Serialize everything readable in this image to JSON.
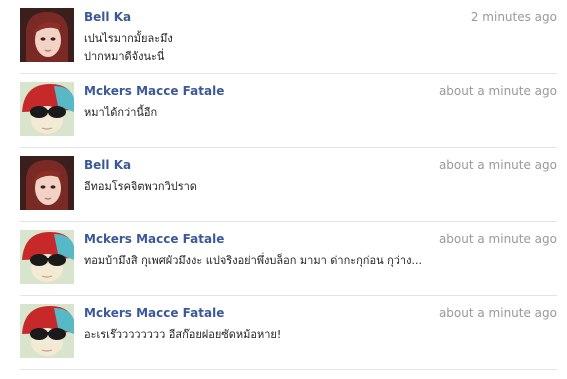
{
  "messages": [
    {
      "author": "Bell Ka",
      "time": "2 minutes ago",
      "avatar_icon": "girl-portrait-avatar",
      "lines": [
        "เปนไรมากมั้ยละมึง",
        "ปากหมาดีจังนะนี่"
      ]
    },
    {
      "author": "Mckers Macce Fatale",
      "time": "about a minute ago",
      "avatar_icon": "sunglasses-red-hair-avatar",
      "lines": [
        "หมาได้กว่านี้อีก"
      ]
    },
    {
      "author": "Bell Ka",
      "time": "about a minute ago",
      "avatar_icon": "girl-portrait-avatar",
      "lines": [
        "อีทอมโรคจิตพวกวิปราด"
      ]
    },
    {
      "author": "Mckers Macce Fatale",
      "time": "about a minute ago",
      "avatar_icon": "sunglasses-red-hair-avatar",
      "lines": [
        "ทอมบ้ามึงสิ กุเพศผัวมึงงะ แปจริงอย่าพึ่งบล็อก มามา ด่ากะกุก่อน กุว่าง..."
      ]
    },
    {
      "author": "Mckers Macce Fatale",
      "time": "about a minute ago",
      "avatar_icon": "sunglasses-red-hair-avatar",
      "lines": [
        "อะเรเร๊วววววววว อีสก๊อยฝอยซัดหม้อหาย!"
      ]
    }
  ],
  "colors": {
    "author": "#3b5998",
    "time": "#999999",
    "text": "#222222",
    "divider": "#e2e5ec"
  }
}
